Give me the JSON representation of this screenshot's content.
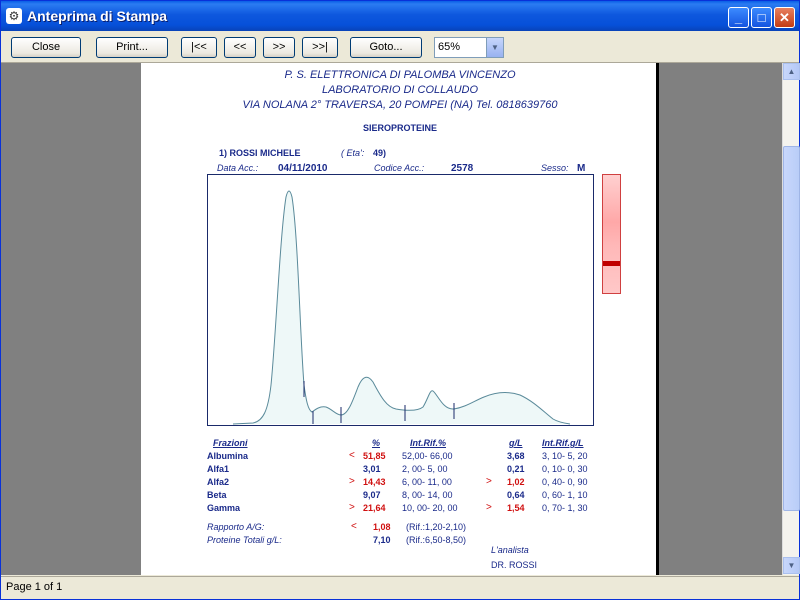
{
  "window": {
    "title": "Anteprima di Stampa"
  },
  "toolbar": {
    "close": "Close",
    "print": "Print...",
    "first": "|<<",
    "prev": "<<",
    "next": ">>",
    "last": ">>|",
    "goto": "Goto...",
    "zoom": "65%"
  },
  "status": {
    "page": "Page 1 of 1"
  },
  "report": {
    "header1": "P. S. ELETTRONICA DI PALOMBA VINCENZO",
    "header2": "LABORATORIO DI COLLAUDO",
    "header3": "VIA NOLANA 2° TRAVERSA, 20   POMPEI (NA)     Tel. 0818639760",
    "exam": "SIEROPROTEINE",
    "patient": "1) ROSSI   MICHELE",
    "eta_label": "( Eta':",
    "eta_value": "49)",
    "data_label": "Data Acc.:",
    "data_value": "04/11/2010",
    "codice_label": "Codice Acc.:",
    "codice_value": "2578",
    "sesso_label": "Sesso:",
    "sesso_value": "M",
    "col_frazioni": "Frazioni",
    "col_pct": "%",
    "col_intrif_pct": "Int.Rif.%",
    "col_gl": "g/L",
    "col_intrif_gl": "Int.Rif.g/L",
    "fractions": [
      {
        "name": "Albumina",
        "flag": "<",
        "pct": "51,85",
        "ref_pct": "52,00- 66,00",
        "flag2": "",
        "gl": "3,68",
        "ref_gl": "3, 10-   5, 20",
        "red": true,
        "red2": false
      },
      {
        "name": "Alfa1",
        "flag": "",
        "pct": "3,01",
        "ref_pct": "2, 00-   5, 00",
        "flag2": "",
        "gl": "0,21",
        "ref_gl": "0, 10-   0, 30",
        "red": false,
        "red2": false
      },
      {
        "name": "Alfa2",
        "flag": ">",
        "pct": "14,43",
        "ref_pct": "6, 00- 11, 00",
        "flag2": ">",
        "gl": "1,02",
        "ref_gl": "0, 40-   0, 90",
        "red": true,
        "red2": true
      },
      {
        "name": "Beta",
        "flag": "",
        "pct": "9,07",
        "ref_pct": "8, 00- 14, 00",
        "flag2": "",
        "gl": "0,64",
        "ref_gl": "0, 60-   1, 10",
        "red": false,
        "red2": false
      },
      {
        "name": "Gamma",
        "flag": ">",
        "pct": "21,64",
        "ref_pct": "10, 00- 20, 00",
        "flag2": ">",
        "gl": "1,54",
        "ref_gl": "0, 70-   1, 30",
        "red": true,
        "red2": true
      }
    ],
    "rapporto_label": "Rapporto A/G:",
    "rapporto_flag": "<",
    "rapporto_value": "1,08",
    "rapporto_ref": "(Rif.:1,20-2,10)",
    "proteine_label": "Proteine Totali g/L:",
    "proteine_value": "7,10",
    "proteine_ref": "(Rif.:6,50-8,50)",
    "analista_label": "L'analista",
    "analista_name": "DR. ROSSI"
  },
  "colors": {
    "curve": "#5a8a9a",
    "fill": "#eef8f8",
    "flag": "#d01010",
    "text": "#1a2a8a"
  }
}
